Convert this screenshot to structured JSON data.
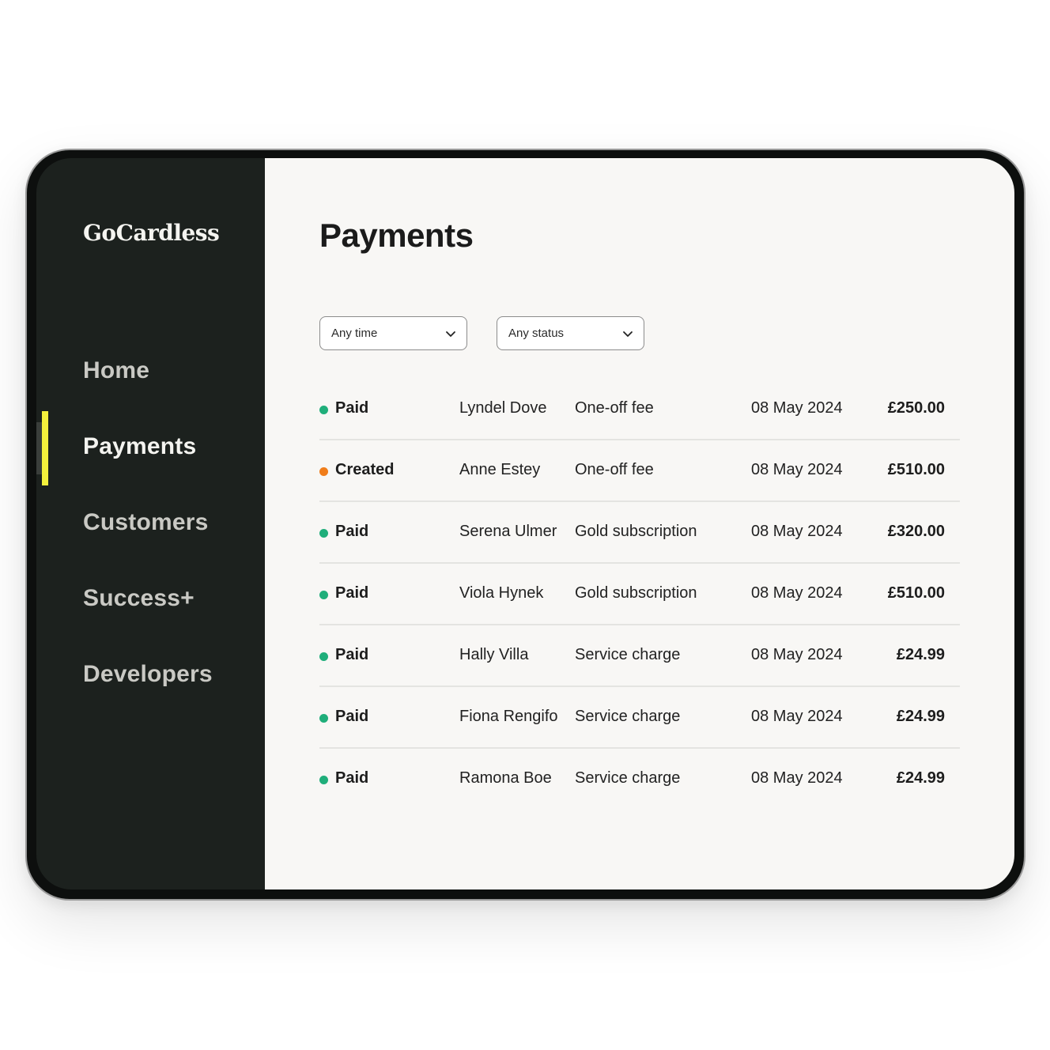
{
  "brand": {
    "name": "GoCardless"
  },
  "colors": {
    "sidebar_bg": "#1c211e",
    "main_bg": "#f8f7f5",
    "active_indicator": "#f4f03c",
    "status_paid": "#1fae7a",
    "status_created": "#f07d1a"
  },
  "sidebar": {
    "items": [
      {
        "label": "Home",
        "active": false
      },
      {
        "label": "Payments",
        "active": true
      },
      {
        "label": "Customers",
        "active": false
      },
      {
        "label": "Success+",
        "active": false
      },
      {
        "label": "Developers",
        "active": false
      }
    ]
  },
  "main": {
    "title": "Payments",
    "filters": {
      "time": {
        "value": "Any time",
        "icon": "chevron-down-icon"
      },
      "status": {
        "value": "Any status",
        "icon": "chevron-down-icon"
      }
    },
    "payments": [
      {
        "status": "Paid",
        "status_type": "paid",
        "customer": "Lyndel Dove",
        "description": "One-off fee",
        "date": "08 May 2024",
        "amount": "£250.00"
      },
      {
        "status": "Created",
        "status_type": "created",
        "customer": "Anne Estey",
        "description": "One-off fee",
        "date": "08 May 2024",
        "amount": "£510.00"
      },
      {
        "status": "Paid",
        "status_type": "paid",
        "customer": "Serena Ulmer",
        "description": "Gold subscription",
        "date": "08 May 2024",
        "amount": "£320.00"
      },
      {
        "status": "Paid",
        "status_type": "paid",
        "customer": "Viola Hynek",
        "description": "Gold subscription",
        "date": "08 May 2024",
        "amount": "£510.00"
      },
      {
        "status": "Paid",
        "status_type": "paid",
        "customer": "Hally Villa",
        "description": "Service charge",
        "date": "08 May 2024",
        "amount": "£24.99"
      },
      {
        "status": "Paid",
        "status_type": "paid",
        "customer": "Fiona Rengifo",
        "description": "Service charge",
        "date": "08 May 2024",
        "amount": "£24.99"
      },
      {
        "status": "Paid",
        "status_type": "paid",
        "customer": "Ramona Boe",
        "description": "Service charge",
        "date": "08 May 2024",
        "amount": "£24.99"
      }
    ]
  }
}
